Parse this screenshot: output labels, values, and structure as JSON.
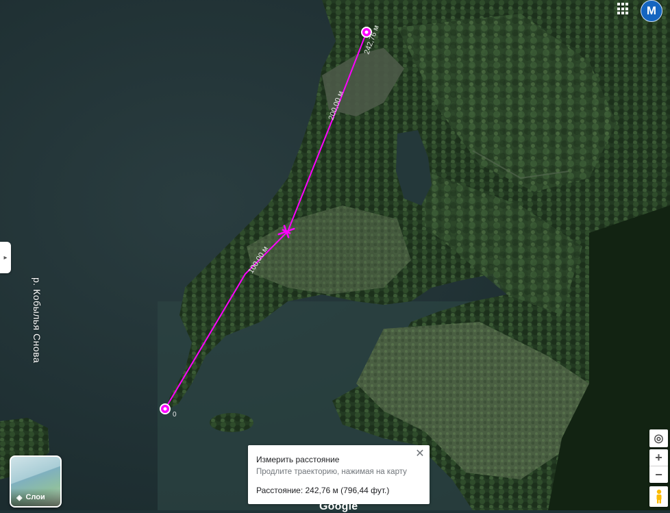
{
  "map": {
    "type": "satellite",
    "river_label": "р. Кобылья Снова",
    "river_label_top": "ва",
    "measure_line_color": "#ff00ff",
    "measure_labels": [
      "100,00 м",
      "200,00 м",
      "242,76 м"
    ],
    "start_label": "0"
  },
  "header": {
    "apps_icon": "apps-grid-icon",
    "avatar_letter": "M"
  },
  "layers": {
    "label": "Слои",
    "icon": "layers-icon"
  },
  "measure": {
    "title": "Измерить расстояние",
    "hint": "Продлите траекторию, нажимая на карту",
    "distance": "Расстояние: 242,76 м (796,44 фут.)",
    "close_icon": "close-icon"
  },
  "controls": {
    "location_icon": "my-location-icon",
    "zoom_in": "+",
    "zoom_out": "−",
    "pegman_icon": "pegman-icon"
  },
  "footer": {
    "brand": "Google"
  }
}
